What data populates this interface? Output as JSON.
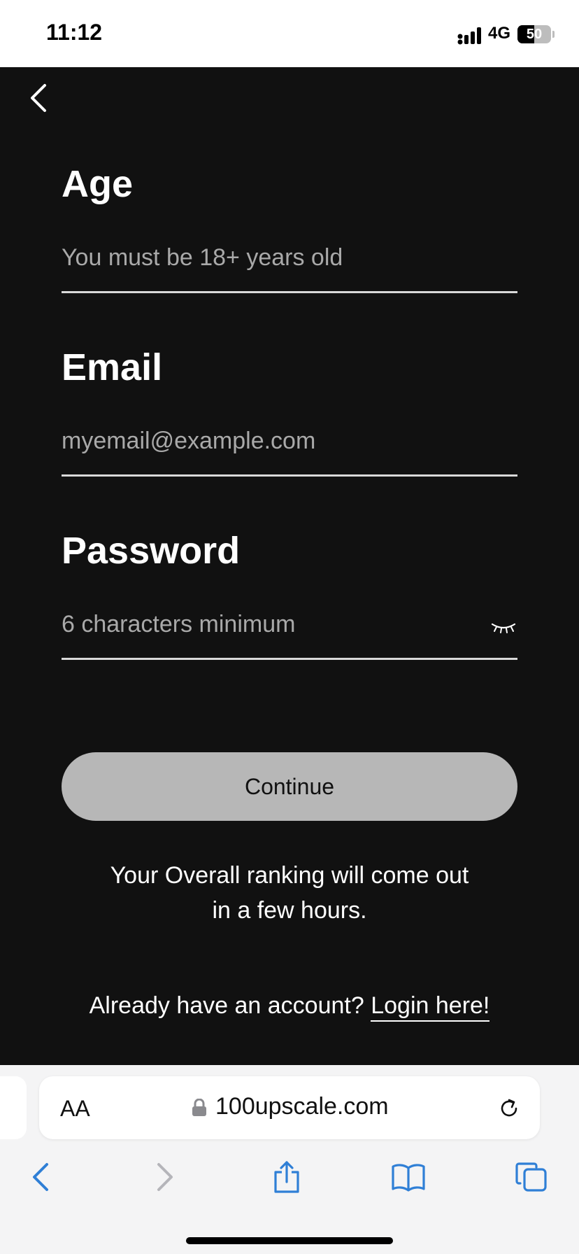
{
  "status_bar": {
    "time": "11:12",
    "network": "4G",
    "battery": "50",
    "battery_level": 0.5
  },
  "form": {
    "age": {
      "label": "Age",
      "placeholder": "You must be 18+ years old"
    },
    "email": {
      "label": "Email",
      "placeholder": "myemail@example.com"
    },
    "password": {
      "label": "Password",
      "placeholder": "6 characters minimum"
    },
    "continue_label": "Continue"
  },
  "ranking_note": {
    "line1": "Your Overall ranking will come out",
    "line2": "in a few hours."
  },
  "login": {
    "prompt": "Already have an account?",
    "link": "Login here!"
  },
  "browser": {
    "text_size_label": "AA",
    "url": "100upscale.com"
  },
  "colors": {
    "app_background": "#111111",
    "button_disabled": "#b7b7b7",
    "safari_accent": "#2f7fd6"
  }
}
